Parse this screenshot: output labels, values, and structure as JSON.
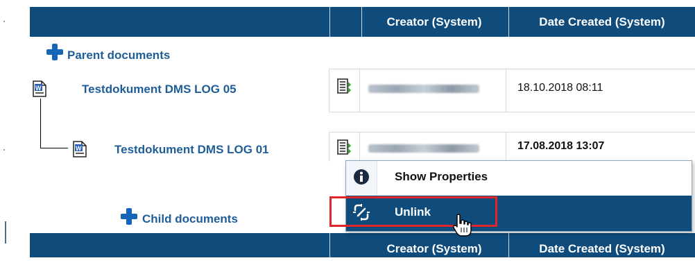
{
  "table_header": {
    "creator_label": "Creator (System)",
    "date_created_label": "Date Created (System)"
  },
  "parent_section": {
    "label": "Parent documents"
  },
  "documents": [
    {
      "name": "Testdokument DMS LOG 05",
      "date": "18.10.2018 08:11",
      "creator": ""
    },
    {
      "name": "Testdokument DMS LOG 01",
      "date": "17.08.2018 13:07",
      "creator": ""
    }
  ],
  "child_section": {
    "label": "Child documents"
  },
  "context_menu": {
    "items": [
      {
        "label": "Show Properties",
        "icon": "info-icon"
      },
      {
        "label": "Unlink",
        "icon": "unlink-icon"
      }
    ]
  },
  "colors": {
    "header_bg": "#0f4c7c",
    "link": "#1f5d99",
    "menu_highlight": "#0f4c7c",
    "highlight_border": "#e0262b"
  }
}
